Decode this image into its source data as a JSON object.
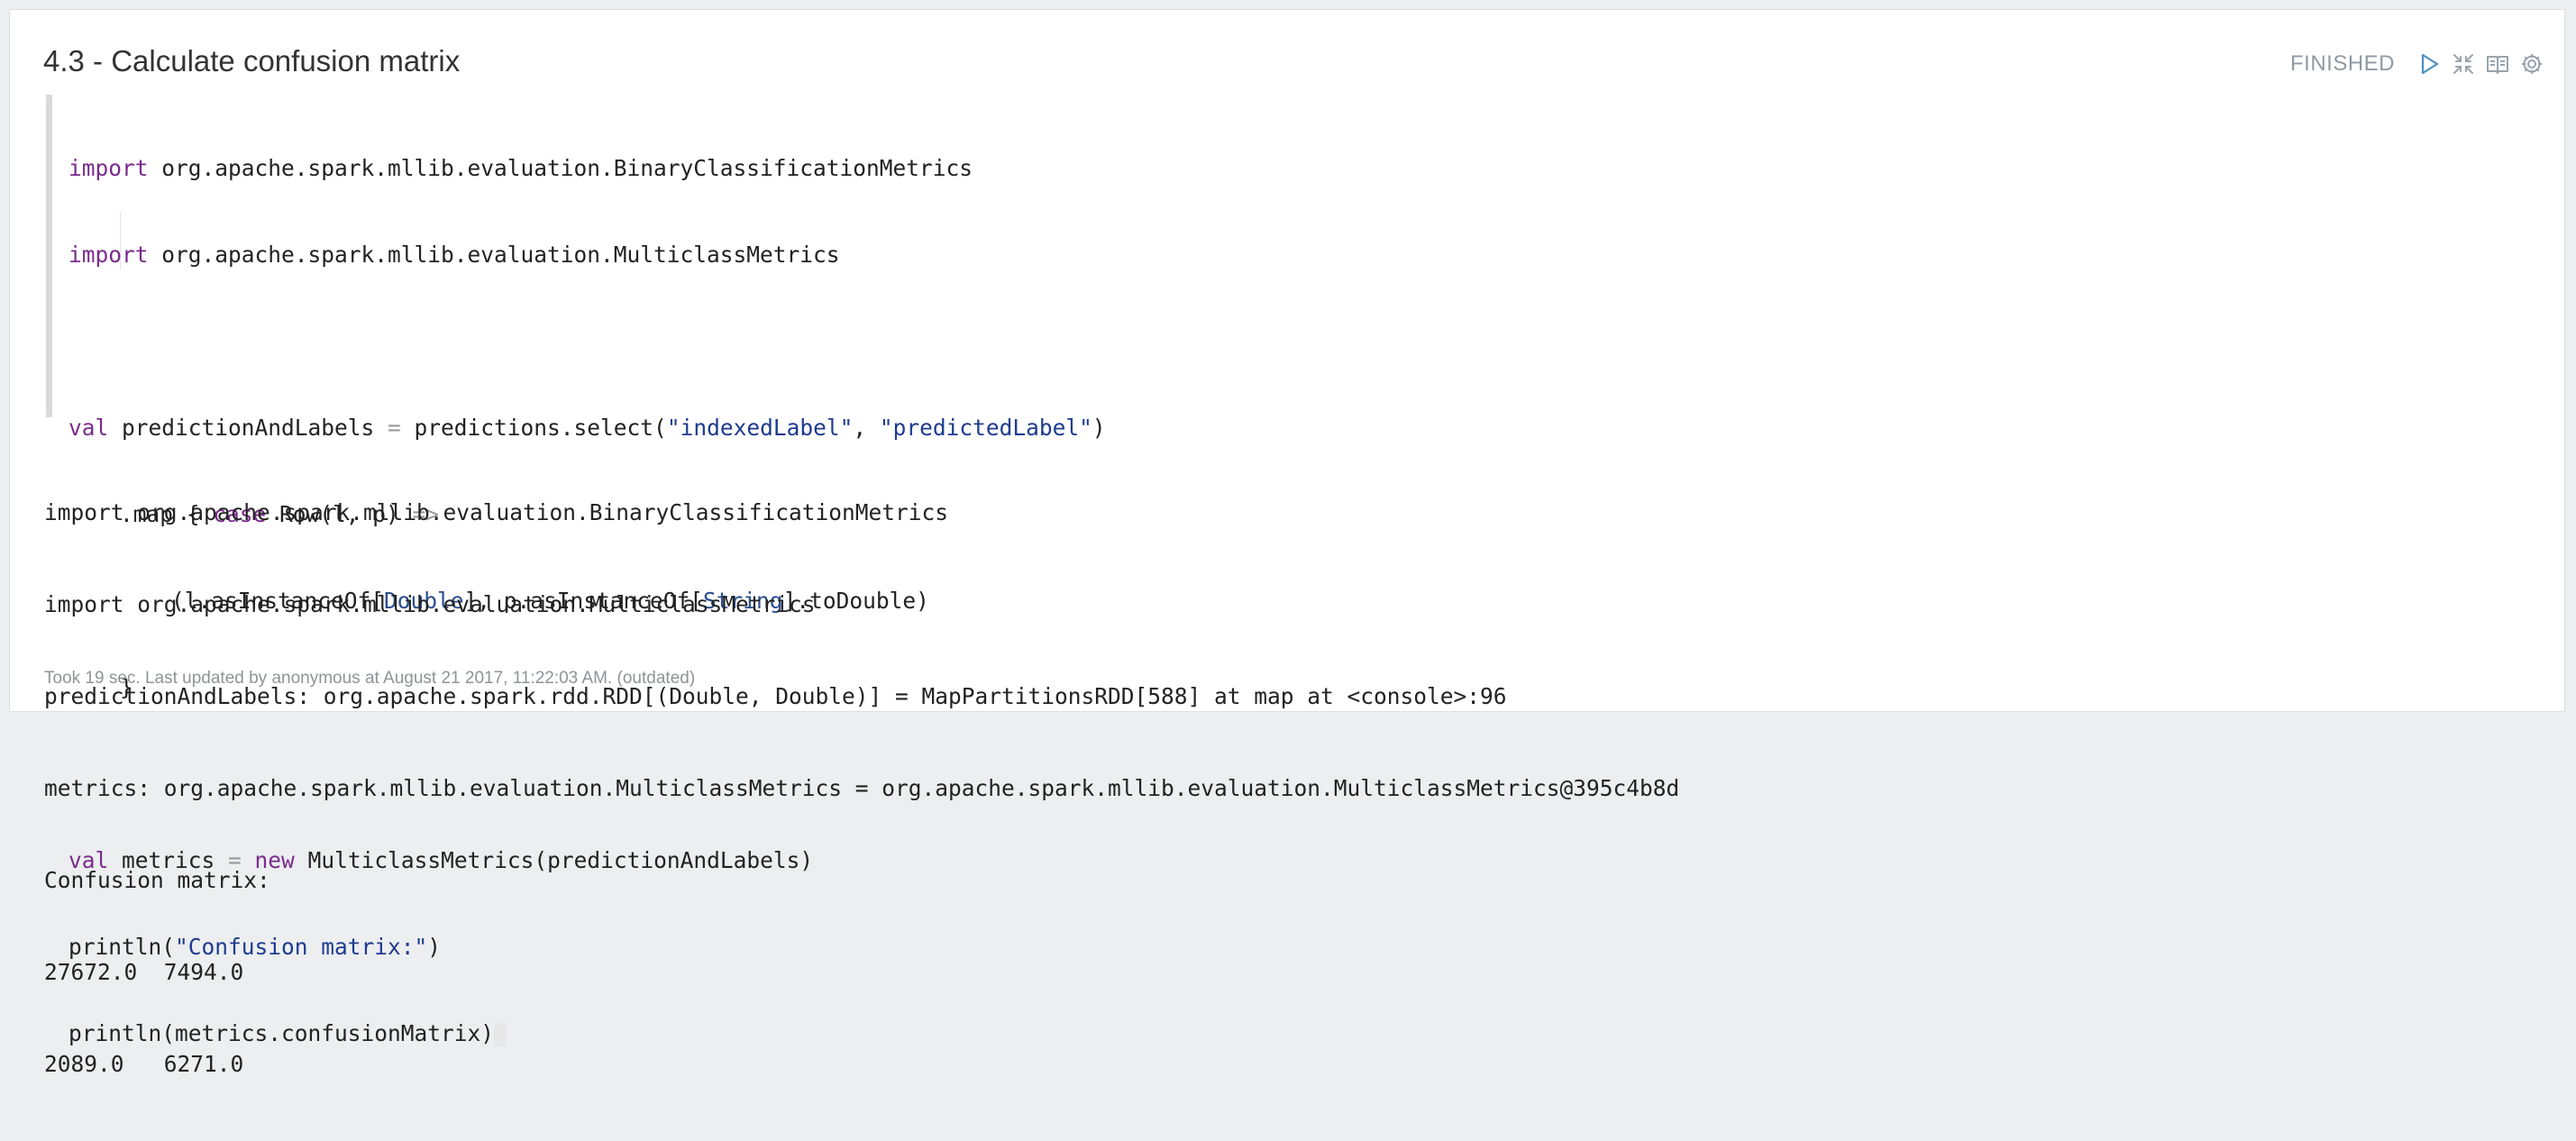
{
  "paragraph": {
    "title": "4.3 - Calculate confusion matrix",
    "status": "FINISHED",
    "controls": [
      "run-icon",
      "collapse-icon",
      "book-icon",
      "settings-icon"
    ]
  },
  "code": {
    "l1_kw": "import",
    "l1_rest": " org.apache.spark.mllib.evaluation.BinaryClassificationMetrics",
    "l2_kw": "import",
    "l2_rest": " org.apache.spark.mllib.evaluation.MulticlassMetrics",
    "l4_kw": "val",
    "l4_a": " predictionAndLabels ",
    "l4_eq": "=",
    "l4_b": " predictions.select(",
    "l4_s1": "\"indexedLabel\"",
    "l4_c": ", ",
    "l4_s2": "\"predictedLabel\"",
    "l4_d": ")",
    "l5_a": ".map { ",
    "l5_kw": "case",
    "l5_b": " Row(l, p) ",
    "l5_arrow": "=>",
    "l6_a": "(l.asInstanceOf[",
    "l6_t1": "Double",
    "l6_b": "], p.asInstanceOf[",
    "l6_t2": "String",
    "l6_c": "].toDouble)",
    "l7": "}",
    "l9_kw": "val",
    "l9_a": " metrics ",
    "l9_eq": "=",
    "l9_new": " new",
    "l9_b": " MulticlassMetrics(predictionAndLabels)",
    "l10_a": "println(",
    "l10_s": "\"Confusion matrix:\"",
    "l10_b": ")",
    "l11": "println(metrics.confusionMatrix)"
  },
  "output": {
    "lines": [
      "import org.apache.spark.mllib.evaluation.BinaryClassificationMetrics",
      "import org.apache.spark.mllib.evaluation.MulticlassMetrics",
      "predictionAndLabels: org.apache.spark.rdd.RDD[(Double, Double)] = MapPartitionsRDD[588] at map at <console>:96",
      "metrics: org.apache.spark.mllib.evaluation.MulticlassMetrics = org.apache.spark.mllib.evaluation.MulticlassMetrics@395c4b8d",
      "Confusion matrix:",
      "27672.0  7494.0",
      "2089.0   6271.0"
    ]
  },
  "footer": {
    "text": "Took 19 sec. Last updated by anonymous at August 21 2017, 11:22:03 AM. (outdated)"
  }
}
